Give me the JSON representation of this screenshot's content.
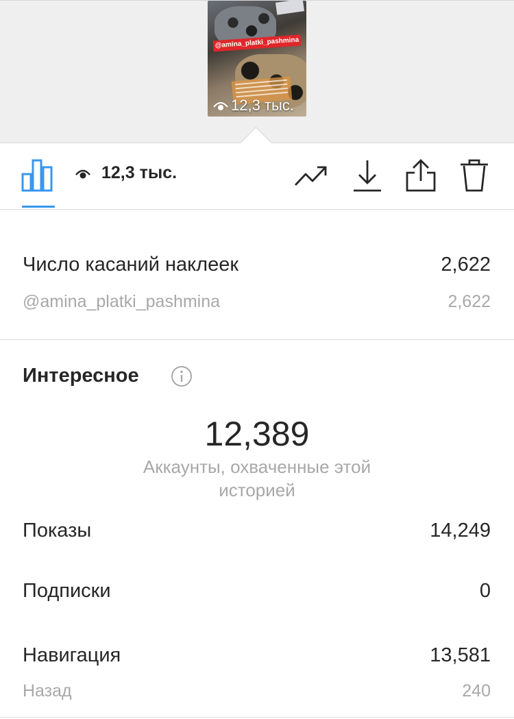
{
  "story_preview": {
    "sticker_text": "@amina_platki_pashmina",
    "views_label": "12,3 тыс."
  },
  "toolbar": {
    "views_label": "12,3 тыс.",
    "icons": [
      "bar-chart-icon",
      "eye-icon",
      "trending-icon",
      "download-icon",
      "share-icon",
      "trash-icon"
    ],
    "accent_color": "#3897f0"
  },
  "sticker_taps": {
    "label": "Число касаний наклеек",
    "value": "2,622",
    "items": [
      {
        "label": "@amina_platki_pashmina",
        "value": "2,622"
      }
    ]
  },
  "discovery": {
    "title": "Интересное",
    "reach_value": "12,389",
    "reach_caption": "Аккаунты, охваченные этой историей",
    "metrics": [
      {
        "label": "Показы",
        "value": "14,249"
      },
      {
        "label": "Подписки",
        "value": "0"
      },
      {
        "label": "Навигация",
        "value": "13,581"
      }
    ],
    "navigation_sub": [
      {
        "label": "Назад",
        "value": "240"
      }
    ]
  }
}
